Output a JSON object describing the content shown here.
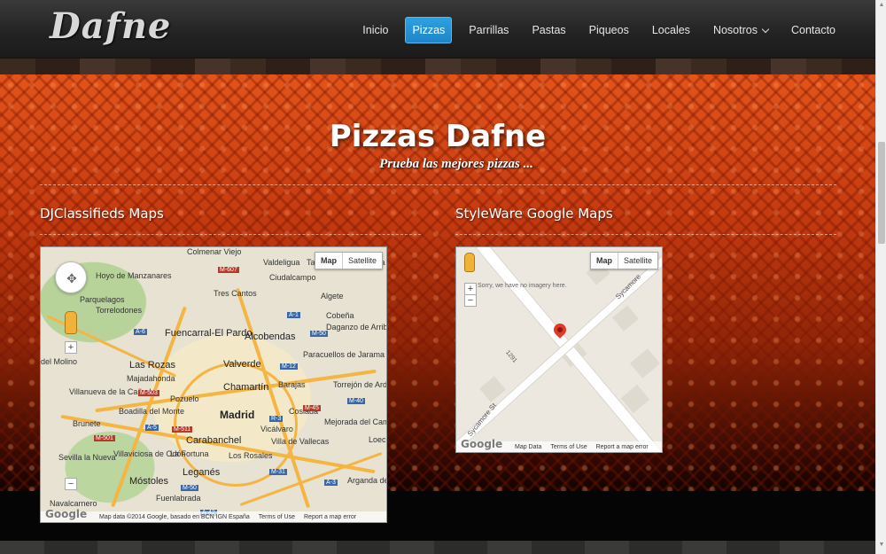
{
  "brand": "Dafne",
  "nav": {
    "items": [
      {
        "label": "Inicio",
        "active": false
      },
      {
        "label": "Pizzas",
        "active": true
      },
      {
        "label": "Parrillas",
        "active": false
      },
      {
        "label": "Pastas",
        "active": false
      },
      {
        "label": "Piqueos",
        "active": false
      },
      {
        "label": "Locales",
        "active": false
      },
      {
        "label": "Nosotros",
        "active": false,
        "dropdown": true
      },
      {
        "label": "Contacto",
        "active": false
      }
    ],
    "active_color": "#2a9ad8"
  },
  "hero": {
    "title": "Pizzas Dafne",
    "subtitle": "Prueba las mejores pizzas ...",
    "background_color": "#d84a18"
  },
  "sections": {
    "left_title": "DJClassifieds Maps",
    "right_title": "StyleWare Google Maps"
  },
  "map1": {
    "map_type": [
      "Map",
      "Satellite"
    ],
    "footer": [
      "Map data ©2014 Google, basado en BCN IGN España",
      "Terms of Use",
      "Report a map error"
    ],
    "google": "Google",
    "places": [
      "Colmenar Viejo",
      "Valdeligua",
      "Talamanca de Jarama",
      "Hoyo de Manzanares",
      "Ciudalcampo",
      "Torrelodones",
      "Parquelagos",
      "Tres Cantos",
      "Algete",
      "Cobeña",
      "Fuencarral-El Pardo",
      "Alcobendas",
      "Daganzo de Arriba",
      "Las Rozas",
      "Majadahonda",
      "Valverde",
      "Paracuellos de Jarama",
      "Chamartín",
      "Barajas",
      "Torrejón de Ardoz",
      "Villanueva de la Cañada",
      "Pozuelo",
      "Boadilla del Monte",
      "Madrid",
      "Coslada",
      "Brunete",
      "Carabanchel",
      "Vicálvaro",
      "Mejorada del Campo",
      "Villaviciosa de Odón",
      "La Fortuna",
      "Los Rosales",
      "Villa de Vallecas",
      "Sevilla la Nueva",
      "Leganés",
      "Móstoles",
      "Arganda del Rey",
      "Navalcarnero",
      "Fuenlabrada",
      "del Molino",
      "Loec"
    ],
    "road_labels": [
      "M-607",
      "A-1",
      "A-6",
      "M-50",
      "M-12",
      "M-503",
      "M-40",
      "R-3",
      "M-45",
      "M-501",
      "A-5",
      "M-511",
      "M-31",
      "A-3",
      "M-50",
      "A-42"
    ]
  },
  "map2": {
    "map_type": [
      "Map",
      "Satellite"
    ],
    "notice": "Sorry, we have no imagery here.",
    "streets": [
      "Sycamore St",
      "Sycamore",
      "1291"
    ],
    "footer": [
      "Map Data",
      "Terms of Use",
      "Report a map error"
    ],
    "google": "Google"
  }
}
